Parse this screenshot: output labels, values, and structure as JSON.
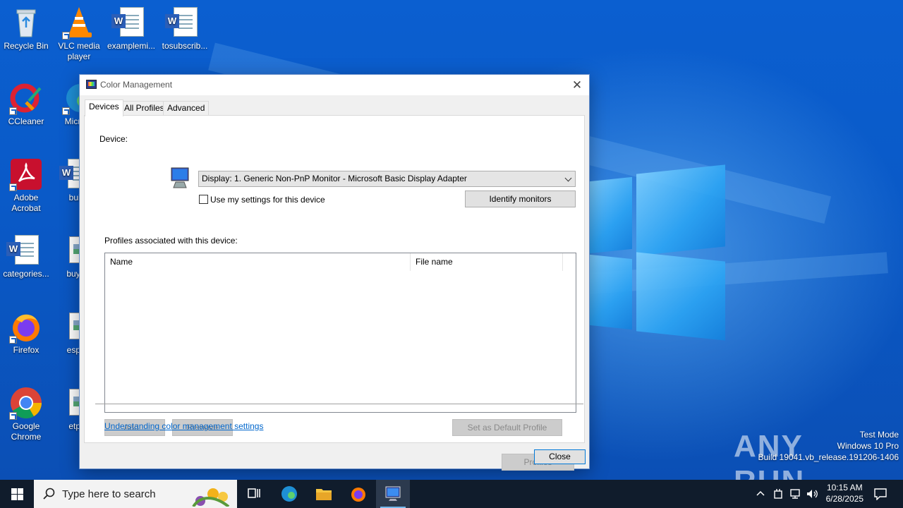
{
  "desktop": {
    "icons": [
      {
        "label": "Recycle Bin"
      },
      {
        "label": "VLC media player"
      },
      {
        "label": "examplemi..."
      },
      {
        "label": "tosubscrib..."
      },
      {
        "label": "CCleaner"
      },
      {
        "label": "Micr Ed"
      },
      {
        "label": "Adobe Acrobat"
      },
      {
        "label": "builth"
      },
      {
        "label": "categories..."
      },
      {
        "label": "buying"
      },
      {
        "label": "Firefox"
      },
      {
        "label": "especi"
      },
      {
        "label": "Google Chrome"
      },
      {
        "label": "etpoc"
      }
    ]
  },
  "dialog": {
    "title": "Color Management",
    "tabs": [
      {
        "label": "Devices",
        "active": true
      },
      {
        "label": "All Profiles",
        "active": false
      },
      {
        "label": "Advanced",
        "active": false
      }
    ],
    "device_label": "Device:",
    "device_value": "Display: 1. Generic Non-PnP Monitor - Microsoft Basic Display Adapter",
    "use_my_settings_label": "Use my settings for this device",
    "use_my_settings_checked": false,
    "identify_monitors_label": "Identify monitors",
    "profiles_label": "Profiles associated with this device:",
    "list_columns": [
      "Name",
      "File name"
    ],
    "list_rows": [],
    "add_label": "Add...",
    "remove_label": "Remove",
    "set_default_label": "Set as Default Profile",
    "profiles_button_label": "Profiles",
    "help_link": "Understanding color management settings",
    "close_label": "Close"
  },
  "watermark": {
    "brand": "ANY RUN",
    "line1": "Test Mode",
    "line2": "Windows 10 Pro",
    "line3": "Build 19041.vb_release.191206-1406"
  },
  "taskbar": {
    "search_placeholder": "Type here to search",
    "time": "10:15 AM",
    "date": "6/28/2025"
  },
  "colors": {
    "accent": "#0078d7",
    "link": "#0066cc",
    "taskbar": "#101c2c"
  }
}
